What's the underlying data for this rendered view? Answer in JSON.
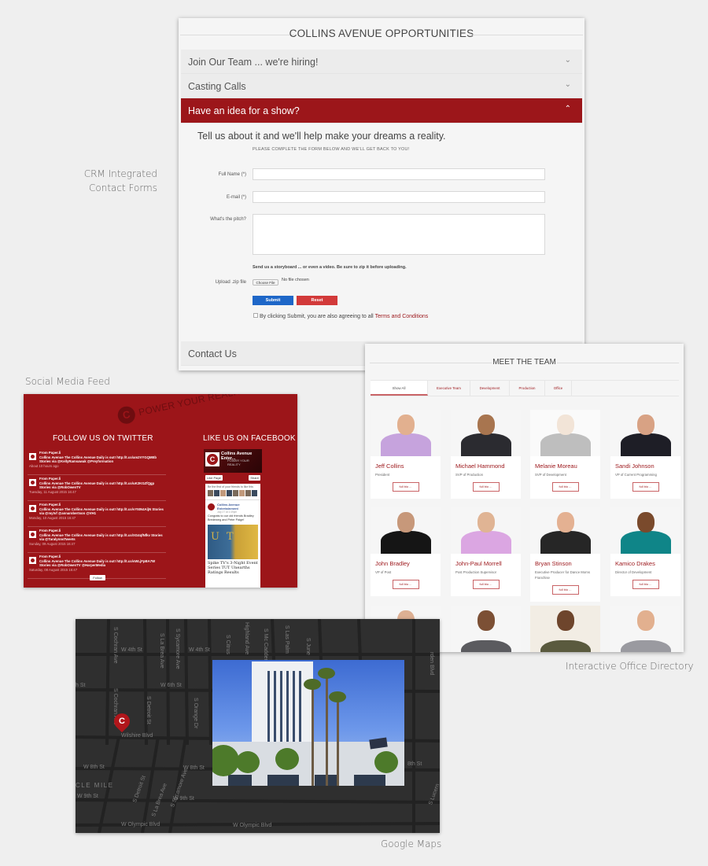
{
  "captions": {
    "crm": [
      "CRM Integrated",
      "Contact Forms"
    ],
    "social": "Social Media Feed",
    "directory": "Interactive Office Directory",
    "maps": "Google Maps"
  },
  "colors": {
    "brand_red": "#9c161a",
    "submit_blue": "#1e67c8",
    "reset_red": "#d23a3a",
    "background": "#efefef"
  },
  "opportunities": {
    "title": "COLLINS AVENUE OPPORTUNITIES",
    "accordion": [
      {
        "label": "Join Our Team ... we're hiring!",
        "expanded": false,
        "icon": "chevron-down-icon"
      },
      {
        "label": "Casting Calls",
        "expanded": false,
        "icon": "chevron-down-icon"
      },
      {
        "label": "Have an idea for a show?",
        "expanded": true,
        "icon": "chevron-up-icon"
      },
      {
        "label": "Contact Us",
        "expanded": false
      }
    ],
    "form": {
      "tagline": "Tell us about it and we'll help make your dreams a reality.",
      "subtagline": "PLEASE COMPLETE THE FORM BELOW AND WE'LL GET BACK TO YOU!",
      "full_name_label": "Full Name (*)",
      "full_name_value": "",
      "email_label": "E-mail (*)",
      "email_value": "",
      "pitch_label": "What's the pitch?",
      "pitch_value": "",
      "upload_note": "Send us a storyboard ... or even a video. Be sure to zip it before uploading.",
      "upload_label": "Upload .zip file",
      "choose_file": "Choose File",
      "no_file": "No file chosen",
      "submit": "Submit",
      "reset": "Reset",
      "terms_prefix": "By clicking Submit, you are also agreeing to all",
      "terms_link": "Terms and Conditions",
      "terms_checked": false
    }
  },
  "social": {
    "brand": "POWER YOUR REALITY™",
    "twitter_heading": "FOLLOW US ON TWITTER",
    "facebook_heading": "LIKE US ON FACEBOOK",
    "tweets": [
      {
        "from": "From Paper.li",
        "text": "Collins Avenue The Collins Avenue Daily is out! http://t.co/am2VYGQMEb Stories via @KellyRamsawak @Preyformation",
        "time": "About 10 hours ago"
      },
      {
        "from": "From Paper.li",
        "text": "Collins Avenue The Collins Avenue Daily is out! http://t.co/uK2KGZfQgp Stories via @RobOwenTV",
        "time": "Tuesday, 11 August 2015 16:47"
      },
      {
        "from": "From Paper.li",
        "text": "Collins Avenue The Collins Avenue Daily is out! http://t.co/vY5tN4AljN Stories via @mytvf @annarobertson @VH1",
        "time": "Monday, 10 August 2015 16:47"
      },
      {
        "from": "From Paper.li",
        "text": "Collins Avenue The Collins Avenue Daily is out! http://t.co/XG4qfNfkv Stories via @TaralynnsTweets",
        "time": "Sunday, 09 August 2015 16:47"
      },
      {
        "from": "From Paper.li",
        "text": "Collins Avenue The Collins Avenue Daily is out! http://t.co/sWLjFpBA7W Stories via @RobOwenTV @HarperMedia",
        "time": "Saturday, 08 August 2015 16:47"
      }
    ],
    "follow_button": "Follow",
    "facebook": {
      "page_name": "Collins Avenue Enter...",
      "page_tagline": "POWER YOUR REALITY",
      "like_page": "Like Page",
      "share": "Share",
      "friends_prompt": "Be the first of your friends to like this",
      "post_author": "Collins Avenue Entertainment",
      "post_time": "July 27 at 1:49pm",
      "post_text": "Congrats to our old friends Bradley Bredeweg and Peter Paige!",
      "post_image_text": "UT",
      "post_headline": "Spike TV's 3-Night Event Series TUT Unearths Ratings Results"
    }
  },
  "team": {
    "title": "MEET THE TEAM",
    "tabs": [
      {
        "label": "Show All",
        "active": true
      },
      {
        "label": "Executive Team",
        "active": false
      },
      {
        "label": "Development",
        "active": false
      },
      {
        "label": "Production",
        "active": false
      },
      {
        "label": "Office",
        "active": false
      }
    ],
    "members": [
      {
        "name": "Jeff Collins",
        "role": "President",
        "bio": "full bio ..."
      },
      {
        "name": "Michael Hammond",
        "role": "SVP of Production",
        "bio": "full bio ..."
      },
      {
        "name": "Melanie Moreau",
        "role": "SVP of Development",
        "bio": "full bio ..."
      },
      {
        "name": "Sandi Johnson",
        "role": "VP of Current Programming",
        "bio": "full bio ..."
      },
      {
        "name": "John Bradley",
        "role": "VP of Post",
        "bio": "full bio ..."
      },
      {
        "name": "John-Paul Morrell",
        "role": "Post Production Supervisor",
        "bio": "full bio ..."
      },
      {
        "name": "Bryan Stinson",
        "role": "Executive Producer for Dance Moms Franchise",
        "bio": "full bio ..."
      },
      {
        "name": "Kamico Drakes",
        "role": "Director of Development",
        "bio": "full bio ..."
      }
    ]
  },
  "map": {
    "district": "CLE MILE",
    "streets": {
      "w4th_a": "W 4th St",
      "w4th_b": "W 4th St",
      "w6th": "W 6th St",
      "w6th_left": "h St",
      "wilshire": "Wilshire Blvd",
      "w8th_a": "W 8th St",
      "w8th_b": "W 8th St",
      "w8th_c": "8th St",
      "w9th_a": "W 9th St",
      "w9th_b": "W 9th St",
      "w9th_c": "W 9th St",
      "w9th_d": "W 9th St",
      "olympic_a": "W Olympic Blvd",
      "olympic_b": "W Olympic Blvd",
      "cochran_a": "S Cochran Ave",
      "cochran_b": "S Cochran Ave",
      "labrea_a": "S La Brea Ave",
      "labrea_b": "S La Brea Ave",
      "sycamore_a": "S Sycamore Ave",
      "sycamore_b": "S Sycamore Ave",
      "citrus": "S Citrus",
      "detroit_a": "S Detroit St",
      "detroit_b": "S Detroit St",
      "orange": "S Orange Dr",
      "highland": "Highland Ave",
      "mccadden": "S Mc Cadden",
      "laspalmas": "S Las Palm",
      "june": "S June",
      "arden": "rden Blvd",
      "lucerne": "S Lucern"
    },
    "marker_icon": "location-pin-icon"
  }
}
